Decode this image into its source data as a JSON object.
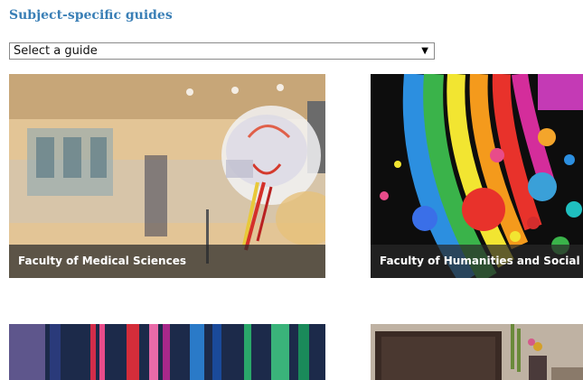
{
  "section": {
    "title": "Subject-specific guides"
  },
  "guide_select": {
    "value": "Select a guide"
  },
  "cards": [
    {
      "label": "Faculty of Medical Sciences"
    },
    {
      "label": "Faculty of Humanities and Social Sciences"
    },
    {
      "label": ""
    },
    {
      "label": ""
    }
  ]
}
